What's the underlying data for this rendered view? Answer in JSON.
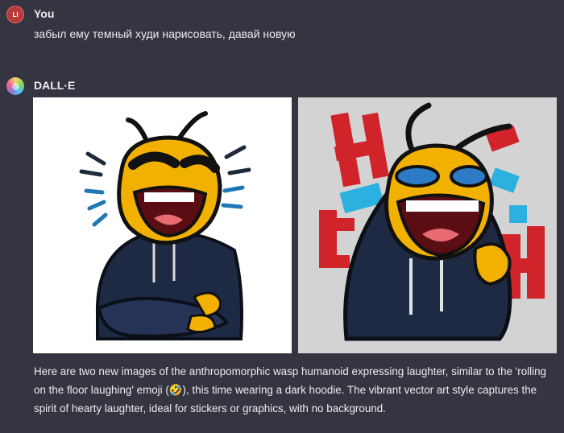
{
  "user_message": {
    "avatar_initials": "LI",
    "author": "You",
    "text": "забыл ему темный худи нарисовать, давай новую"
  },
  "assistant_message": {
    "author": "DALL·E",
    "images": [
      {
        "icon": "laughing-wasp-arms-crossed-image",
        "background": "#ffffff"
      },
      {
        "icon": "laughing-wasp-fist-image",
        "background": "#d3d3d3"
      }
    ],
    "description_before_emoji": "Here are two new images of the anthropomorphic wasp humanoid expressing laughter, similar to the 'rolling on the floor laughing' emoji (",
    "emoji": "🤣",
    "description_after_emoji": "), this time wearing a dark hoodie. The vibrant vector art style captures the spirit of hearty laughter, ideal for stickers or graphics, with no background."
  },
  "colors": {
    "background": "#343541",
    "text": "#ececf1",
    "user_avatar": "#b83a3a",
    "wasp_yellow": "#f2b100",
    "hoodie": "#1e2a44",
    "accent_red": "#d1232a",
    "accent_blue": "#2bb0e0"
  }
}
